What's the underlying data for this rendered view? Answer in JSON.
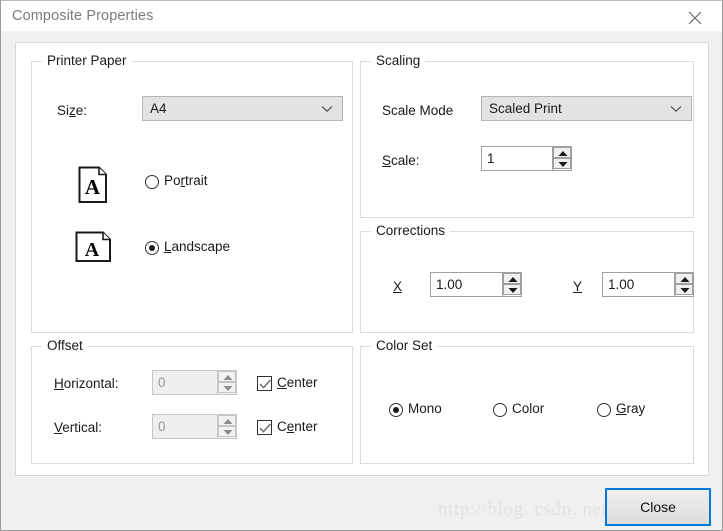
{
  "window": {
    "title": "Composite Properties",
    "close_icon": "close-icon"
  },
  "printer_paper": {
    "legend": "Printer Paper",
    "size_label_pre": "Si",
    "size_label_acc": "z",
    "size_label_post": "e:",
    "size_value": "A4",
    "size_options": [
      "A4"
    ],
    "orientation": [
      {
        "pre": "Po",
        "acc": "r",
        "post": "trait",
        "selected": false,
        "icon": "portrait-page-icon"
      },
      {
        "pre": "",
        "acc": "L",
        "post": "andscape",
        "selected": true,
        "icon": "landscape-page-icon"
      }
    ]
  },
  "offset": {
    "legend": "Offset",
    "horizontal_label_pre": "",
    "horizontal_label_acc": "H",
    "horizontal_label_post": "orizontal:",
    "horizontal_value": "0",
    "horizontal_center_pre": "",
    "horizontal_center_acc": "C",
    "horizontal_center_post": "enter",
    "horizontal_center_checked": true,
    "vertical_label_pre": "",
    "vertical_label_acc": "V",
    "vertical_label_post": "ertical:",
    "vertical_value": "0",
    "vertical_center_pre": "C",
    "vertical_center_acc": "e",
    "vertical_center_post": "nter",
    "vertical_center_checked": true
  },
  "scaling": {
    "legend": "Scaling",
    "mode_label": "Scale Mode",
    "mode_value": "Scaled Print",
    "mode_options": [
      "Scaled Print"
    ],
    "scale_label_pre": "",
    "scale_label_acc": "S",
    "scale_label_post": "cale:",
    "scale_value": "1"
  },
  "corrections": {
    "legend": "Corrections",
    "x_label": "X",
    "x_value": "1.00",
    "y_label": "Y",
    "y_value": "1.00"
  },
  "color_set": {
    "legend": "Color Set",
    "options": [
      {
        "pre": "Mono",
        "acc": "",
        "post": "",
        "selected": true
      },
      {
        "pre": "Color",
        "acc": "",
        "post": "",
        "selected": false
      },
      {
        "pre": "",
        "acc": "G",
        "post": "ray",
        "selected": false
      }
    ]
  },
  "footer": {
    "close_label": "Close"
  },
  "watermark": {
    "text": "http://blog. csdn. net/JSJXMB"
  }
}
